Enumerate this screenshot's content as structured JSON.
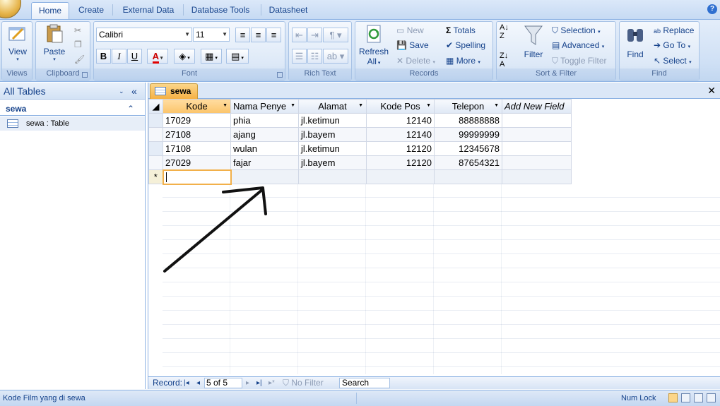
{
  "tabs": [
    "Home",
    "Create",
    "External Data",
    "Database Tools",
    "Datasheet"
  ],
  "ribbon": {
    "views": {
      "view_label": "View",
      "group": "Views"
    },
    "clipboard": {
      "paste_label": "Paste",
      "group": "Clipboard"
    },
    "font": {
      "font_name": "Calibri",
      "font_size": "11",
      "bold": "B",
      "italic": "I",
      "underline": "U",
      "font_color": "A",
      "group": "Font"
    },
    "rich_text": {
      "group": "Rich Text"
    },
    "records": {
      "refresh": "Refresh",
      "refresh2": "All",
      "new": "New",
      "save": "Save",
      "delete": "Delete",
      "totals": "Totals",
      "spelling": "Spelling",
      "more": "More",
      "group": "Records"
    },
    "sort_filter": {
      "filter": "Filter",
      "selection": "Selection",
      "advanced": "Advanced",
      "toggle_filter": "Toggle Filter",
      "group": "Sort & Filter"
    },
    "find": {
      "find": "Find",
      "replace": "Replace",
      "goto": "Go To",
      "select": "Select",
      "group": "Find"
    }
  },
  "nav_pane": {
    "header": "All Tables",
    "group": "sewa",
    "item": "sewa : Table"
  },
  "doc": {
    "tab": "sewa",
    "columns": [
      "Kode",
      "Nama Penye",
      "Alamat",
      "Kode Pos",
      "Telepon",
      "Add New Field"
    ],
    "rows": [
      [
        "17029",
        "phia",
        "jl.ketimun",
        "12140",
        "88888888"
      ],
      [
        "27108",
        "ajang",
        "jl.bayem",
        "12140",
        "99999999"
      ],
      [
        "17108",
        "wulan",
        "jl.ketimun",
        "12120",
        "12345678"
      ],
      [
        "27029",
        "fajar",
        "jl.bayem",
        "12120",
        "87654321"
      ]
    ],
    "new_row_marker": "*"
  },
  "record_nav": {
    "label": "Record:",
    "position": "5 of 5",
    "no_filter": "No Filter",
    "search": "Search"
  },
  "status": {
    "left": "Kode Film yang di sewa",
    "right": "Num Lock"
  }
}
